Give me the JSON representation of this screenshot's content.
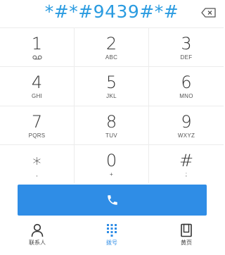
{
  "display": {
    "dialed_number": "*#*#9439#*#",
    "backspace_icon": "backspace-icon"
  },
  "keypad": {
    "keys": [
      {
        "digit": "1",
        "letters": "",
        "sub_icon": "voicemail-icon"
      },
      {
        "digit": "2",
        "letters": "ABC"
      },
      {
        "digit": "3",
        "letters": "DEF"
      },
      {
        "digit": "4",
        "letters": "GHI"
      },
      {
        "digit": "5",
        "letters": "JKL"
      },
      {
        "digit": "6",
        "letters": "MNO"
      },
      {
        "digit": "7",
        "letters": "PQRS"
      },
      {
        "digit": "8",
        "letters": "TUV"
      },
      {
        "digit": "9",
        "letters": "WXYZ"
      },
      {
        "digit": "∗",
        "letters": ","
      },
      {
        "digit": "0",
        "letters": "+"
      },
      {
        "digit": "#",
        "letters": ";"
      }
    ]
  },
  "call": {
    "icon": "phone-icon",
    "color": "#2f8de6"
  },
  "bottom_nav": {
    "items": [
      {
        "label": "联系人",
        "icon": "person-icon",
        "active": false
      },
      {
        "label": "拨号",
        "icon": "dialpad-icon",
        "active": true
      },
      {
        "label": "黄页",
        "icon": "yellow-pages-icon",
        "active": false
      }
    ]
  },
  "colors": {
    "accent": "#2f8de6",
    "digits": "#333333",
    "divider": "#ececec"
  }
}
